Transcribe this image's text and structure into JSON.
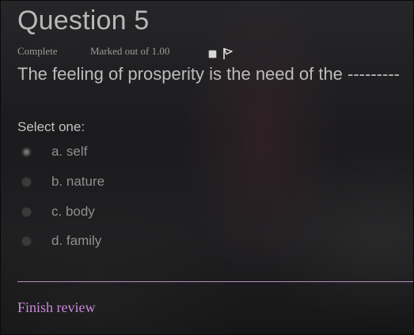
{
  "question": {
    "title": "Question 5",
    "state": "Complete",
    "grade": "Marked out of 1.00",
    "text": "The feeling of prosperity is the need of the ---------",
    "prompt": "Select one:"
  },
  "options": [
    {
      "label": "a. self",
      "checked": true
    },
    {
      "label": "b. nature",
      "checked": false
    },
    {
      "label": "c. body",
      "checked": false
    },
    {
      "label": "d. family",
      "checked": false
    }
  ],
  "footer": {
    "finish_label": "Finish review"
  },
  "icons": {
    "flag": "flag-icon",
    "flag_checkbox": "checkbox"
  },
  "colors": {
    "link": "#c88ad8",
    "divider": "#b68cc2"
  }
}
